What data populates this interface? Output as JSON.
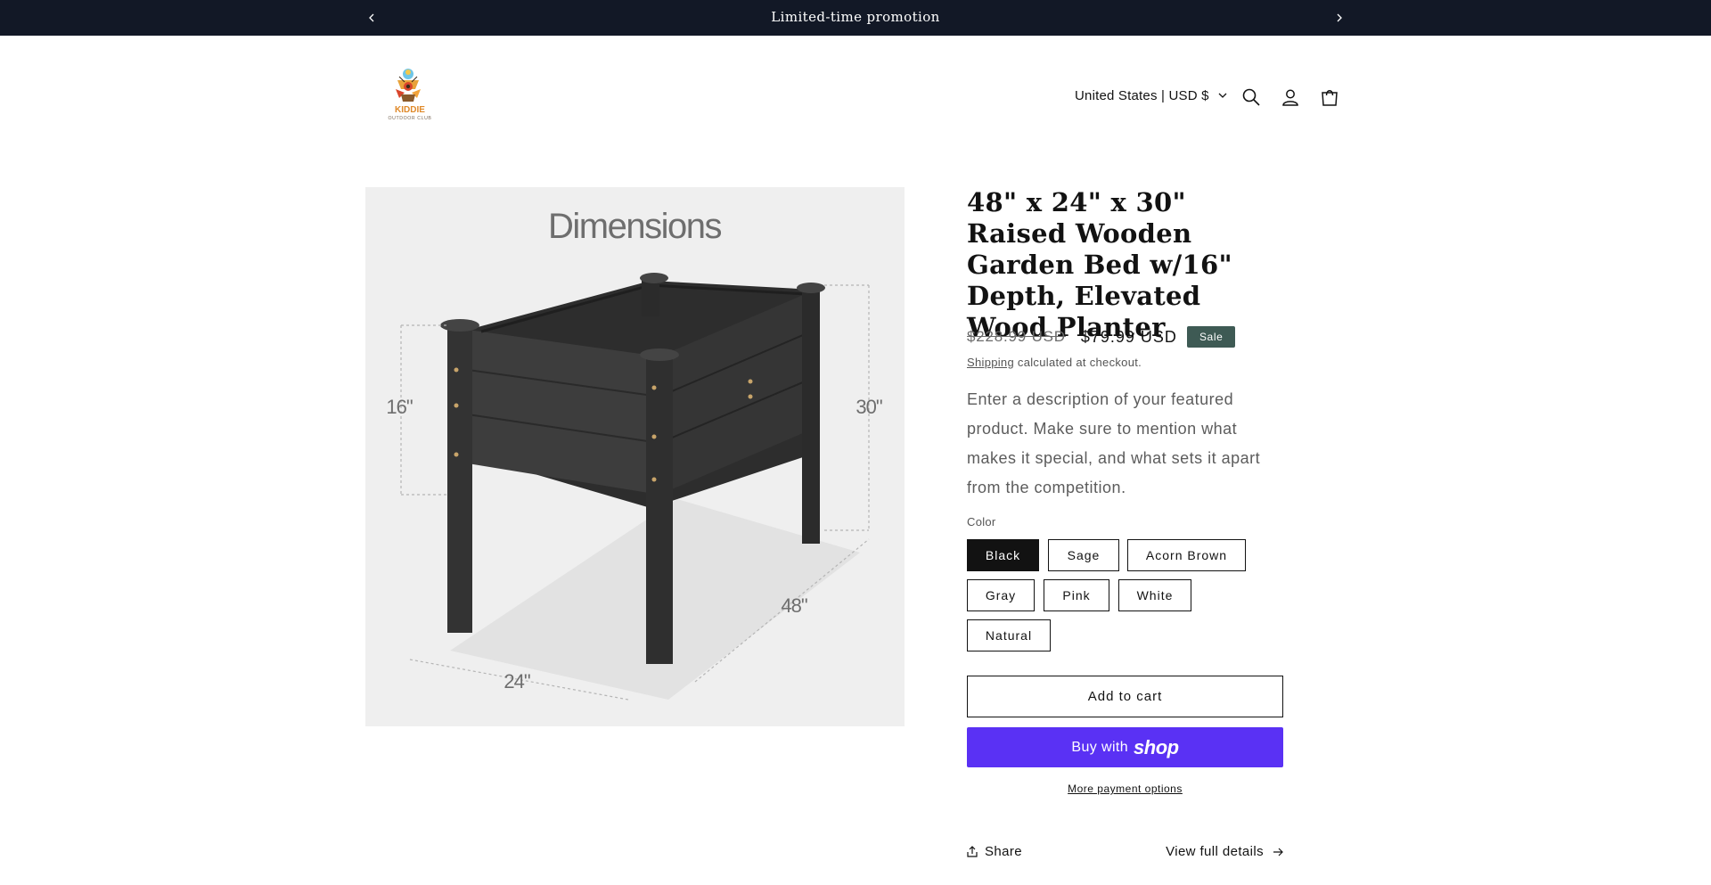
{
  "announcement": {
    "message": "Limited-time promotion",
    "prev_icon": "chevron-left-icon",
    "next_icon": "chevron-right-icon"
  },
  "header": {
    "logo": {
      "name": "KIDDIE",
      "tagline": "OUTDOOR CLUB"
    },
    "country_selector": "United States | USD $",
    "icons": [
      "search-icon",
      "account-icon",
      "cart-icon"
    ]
  },
  "product": {
    "image_text": {
      "heading": "Dimensions",
      "dim_16": "16\"",
      "dim_30": "30\"",
      "dim_48": "48\"",
      "dim_24": "24\""
    },
    "title": "48\" x 24\" x 30\" Raised Wooden Garden Bed w/16\" Depth, Elevated Wood Planter",
    "price_regular": "$228.99 USD",
    "price_sale": "$79.99 USD",
    "badge": "Sale",
    "shipping_link": "Shipping",
    "shipping_text": " calculated at checkout.",
    "description": "Enter a description of your featured product. Make sure to mention what makes it special, and what sets it apart from the competition.",
    "color_label": "Color",
    "colors": [
      "Black",
      "Sage",
      "Acorn Brown",
      "Gray",
      "Pink",
      "White",
      "Natural"
    ],
    "selected_color": "Black",
    "add_to_cart": "Add to cart",
    "buy_with": "Buy with",
    "shop_brand": "shop",
    "more_payment": "More payment options",
    "share": "Share",
    "view_full": "View full details"
  },
  "colors": {
    "announcement_bg": "#121826",
    "sale_badge": "#3e5a54",
    "shop_pay": "#5a31f4"
  }
}
